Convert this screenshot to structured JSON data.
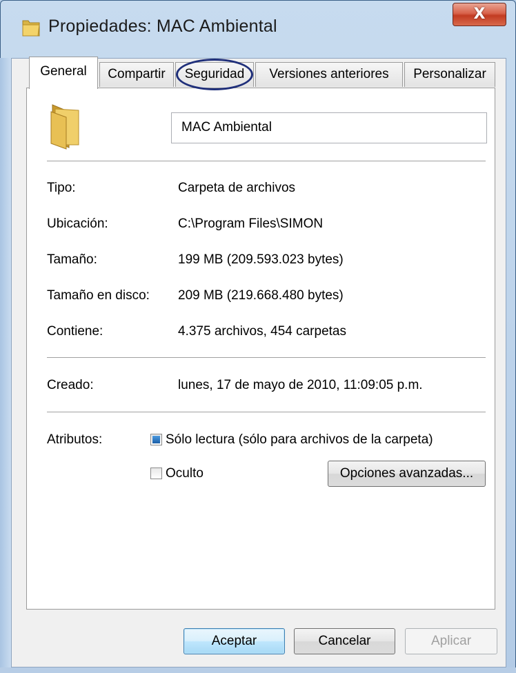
{
  "window": {
    "title": "Propiedades: MAC Ambiental",
    "close_label": "X"
  },
  "tabs": [
    {
      "label": "General",
      "active": true
    },
    {
      "label": "Compartir",
      "active": false
    },
    {
      "label": "Seguridad",
      "active": false
    },
    {
      "label": "Versiones anteriores",
      "active": false
    },
    {
      "label": "Personalizar",
      "active": false
    }
  ],
  "general": {
    "folder_name": "MAC Ambiental",
    "rows": [
      {
        "label": "Tipo:",
        "value": "Carpeta de archivos"
      },
      {
        "label": "Ubicación:",
        "value": "C:\\Program Files\\SIMON"
      },
      {
        "label": "Tamaño:",
        "value": "199 MB (209.593.023 bytes)"
      },
      {
        "label": "Tamaño en disco:",
        "value": "209 MB (219.668.480 bytes)"
      },
      {
        "label": "Contiene:",
        "value": "4.375 archivos, 454 carpetas"
      }
    ],
    "created": {
      "label": "Creado:",
      "value": "lunes, 17 de mayo de 2010, 11:09:05 p.m."
    },
    "attributes": {
      "label": "Atributos:",
      "readonly_label": "Sólo lectura (sólo para archivos de la carpeta)",
      "readonly_state": "indeterminate",
      "hidden_label": "Oculto",
      "hidden_checked": false,
      "advanced_button": "Opciones avanzadas..."
    }
  },
  "footer": {
    "ok": "Aceptar",
    "cancel": "Cancelar",
    "apply": "Aplicar"
  },
  "colors": {
    "highlight_ring": "#1f2f7a",
    "close_button": "#c23b22"
  }
}
